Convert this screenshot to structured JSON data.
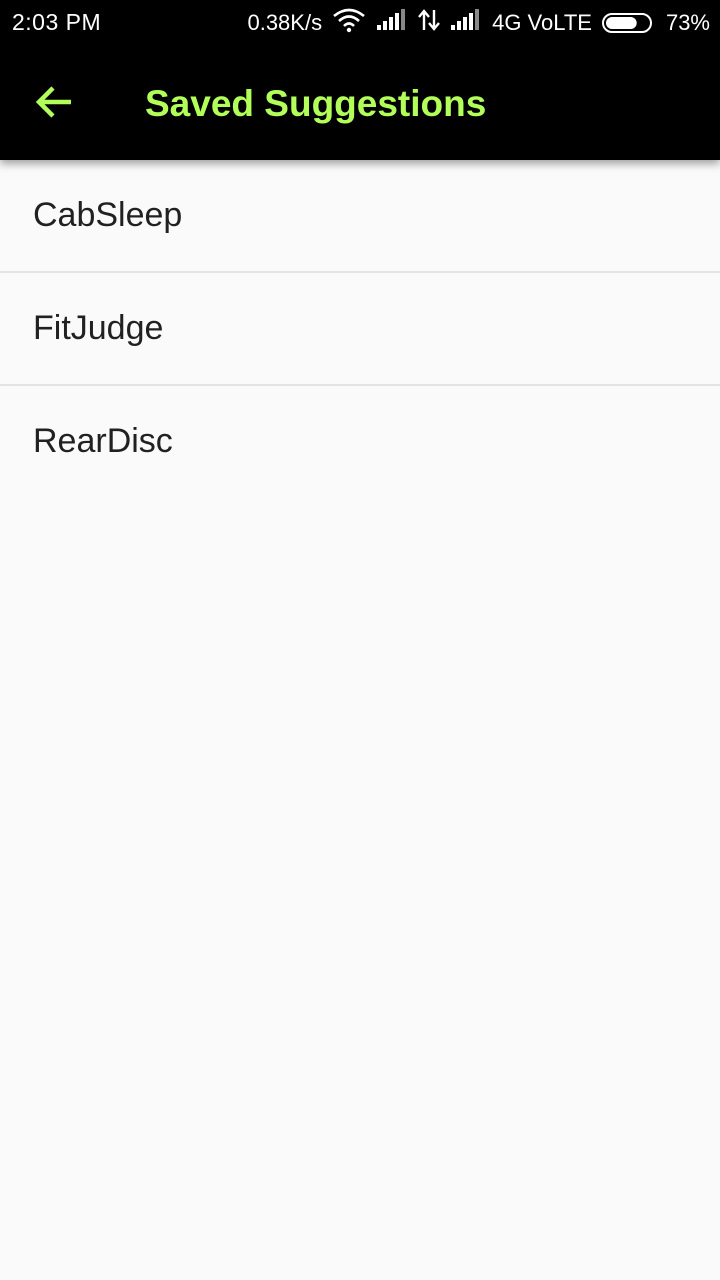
{
  "status_bar": {
    "time": "2:03 PM",
    "network_speed": "0.38K/s",
    "network_type": "4G VoLTE",
    "battery_percent": "73%",
    "battery_level": 0.73,
    "icons": [
      "wifi-icon",
      "signal-icon",
      "data-transfer-icon",
      "signal-icon",
      "battery-icon"
    ]
  },
  "app_bar": {
    "title": "Saved Suggestions",
    "back_icon": "arrow-back-icon",
    "accent_color": "#b2ff59",
    "background_color": "#000000"
  },
  "suggestions": [
    {
      "label": "CabSleep"
    },
    {
      "label": "FitJudge"
    },
    {
      "label": "RearDisc"
    }
  ]
}
